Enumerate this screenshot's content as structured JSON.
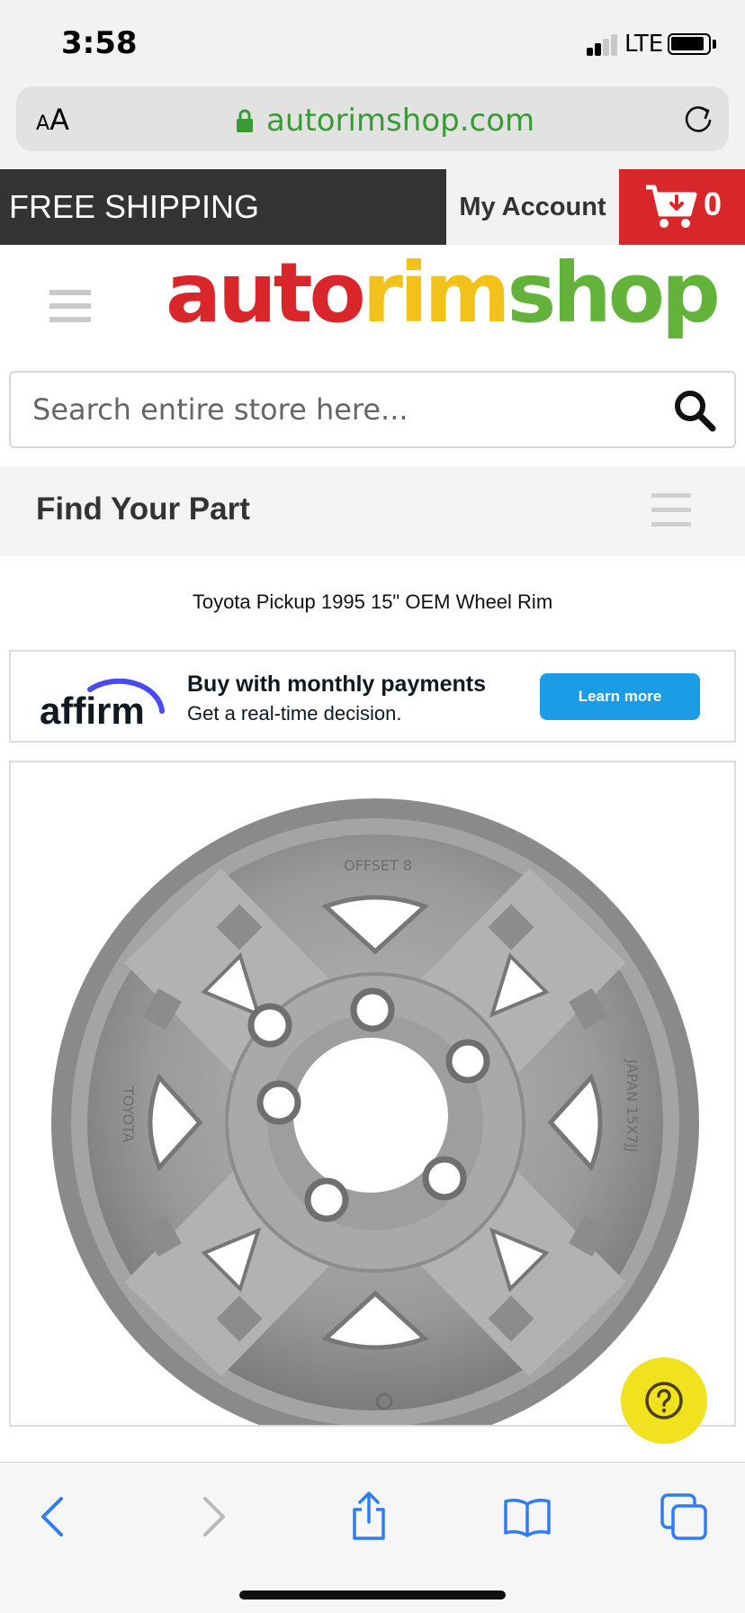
{
  "status_bar": {
    "time": "3:58",
    "network": "LTE",
    "signal_bars_active": 2,
    "signal_bars_total": 4
  },
  "browser": {
    "text_size_small": "A",
    "text_size_large": "A",
    "url": "autorimshop.com",
    "icons": [
      "lock-icon",
      "reload-icon"
    ]
  },
  "top_strip": {
    "free_shipping": "FREE SHIPPING",
    "my_account": "My Account",
    "cart_count": "0",
    "colors": {
      "dark": "#333333",
      "light": "#f2f2f2",
      "cart": "#d9262b"
    }
  },
  "header": {
    "logo_part1": "auto",
    "logo_part2": "rim",
    "logo_part3": "shop",
    "logo_colors": [
      "#d9262b",
      "#f2c21b",
      "#63b33a"
    ]
  },
  "search": {
    "placeholder": "Search entire store here...",
    "icon": "search-icon"
  },
  "find_part": {
    "title": "Find Your Part"
  },
  "product": {
    "title": "Toyota Pickup 1995 15\" OEM Wheel Rim",
    "wheel_text_top": "OFFSET 8",
    "wheel_text_left": "TOYOTA",
    "wheel_text_right": "JAPAN 15X7JJ"
  },
  "affirm": {
    "logo_text": "affirm",
    "headline": "Buy with monthly payments",
    "subline": "Get a real-time decision.",
    "button": "Learn more",
    "accent": "#1a9ce6"
  },
  "help": {
    "icon": "question-icon",
    "color": "#f0e21e"
  },
  "toolbar": {
    "icons": [
      "back-icon",
      "forward-icon",
      "share-icon",
      "bookmarks-icon",
      "tabs-icon"
    ],
    "tint": "#2f7cf6"
  }
}
